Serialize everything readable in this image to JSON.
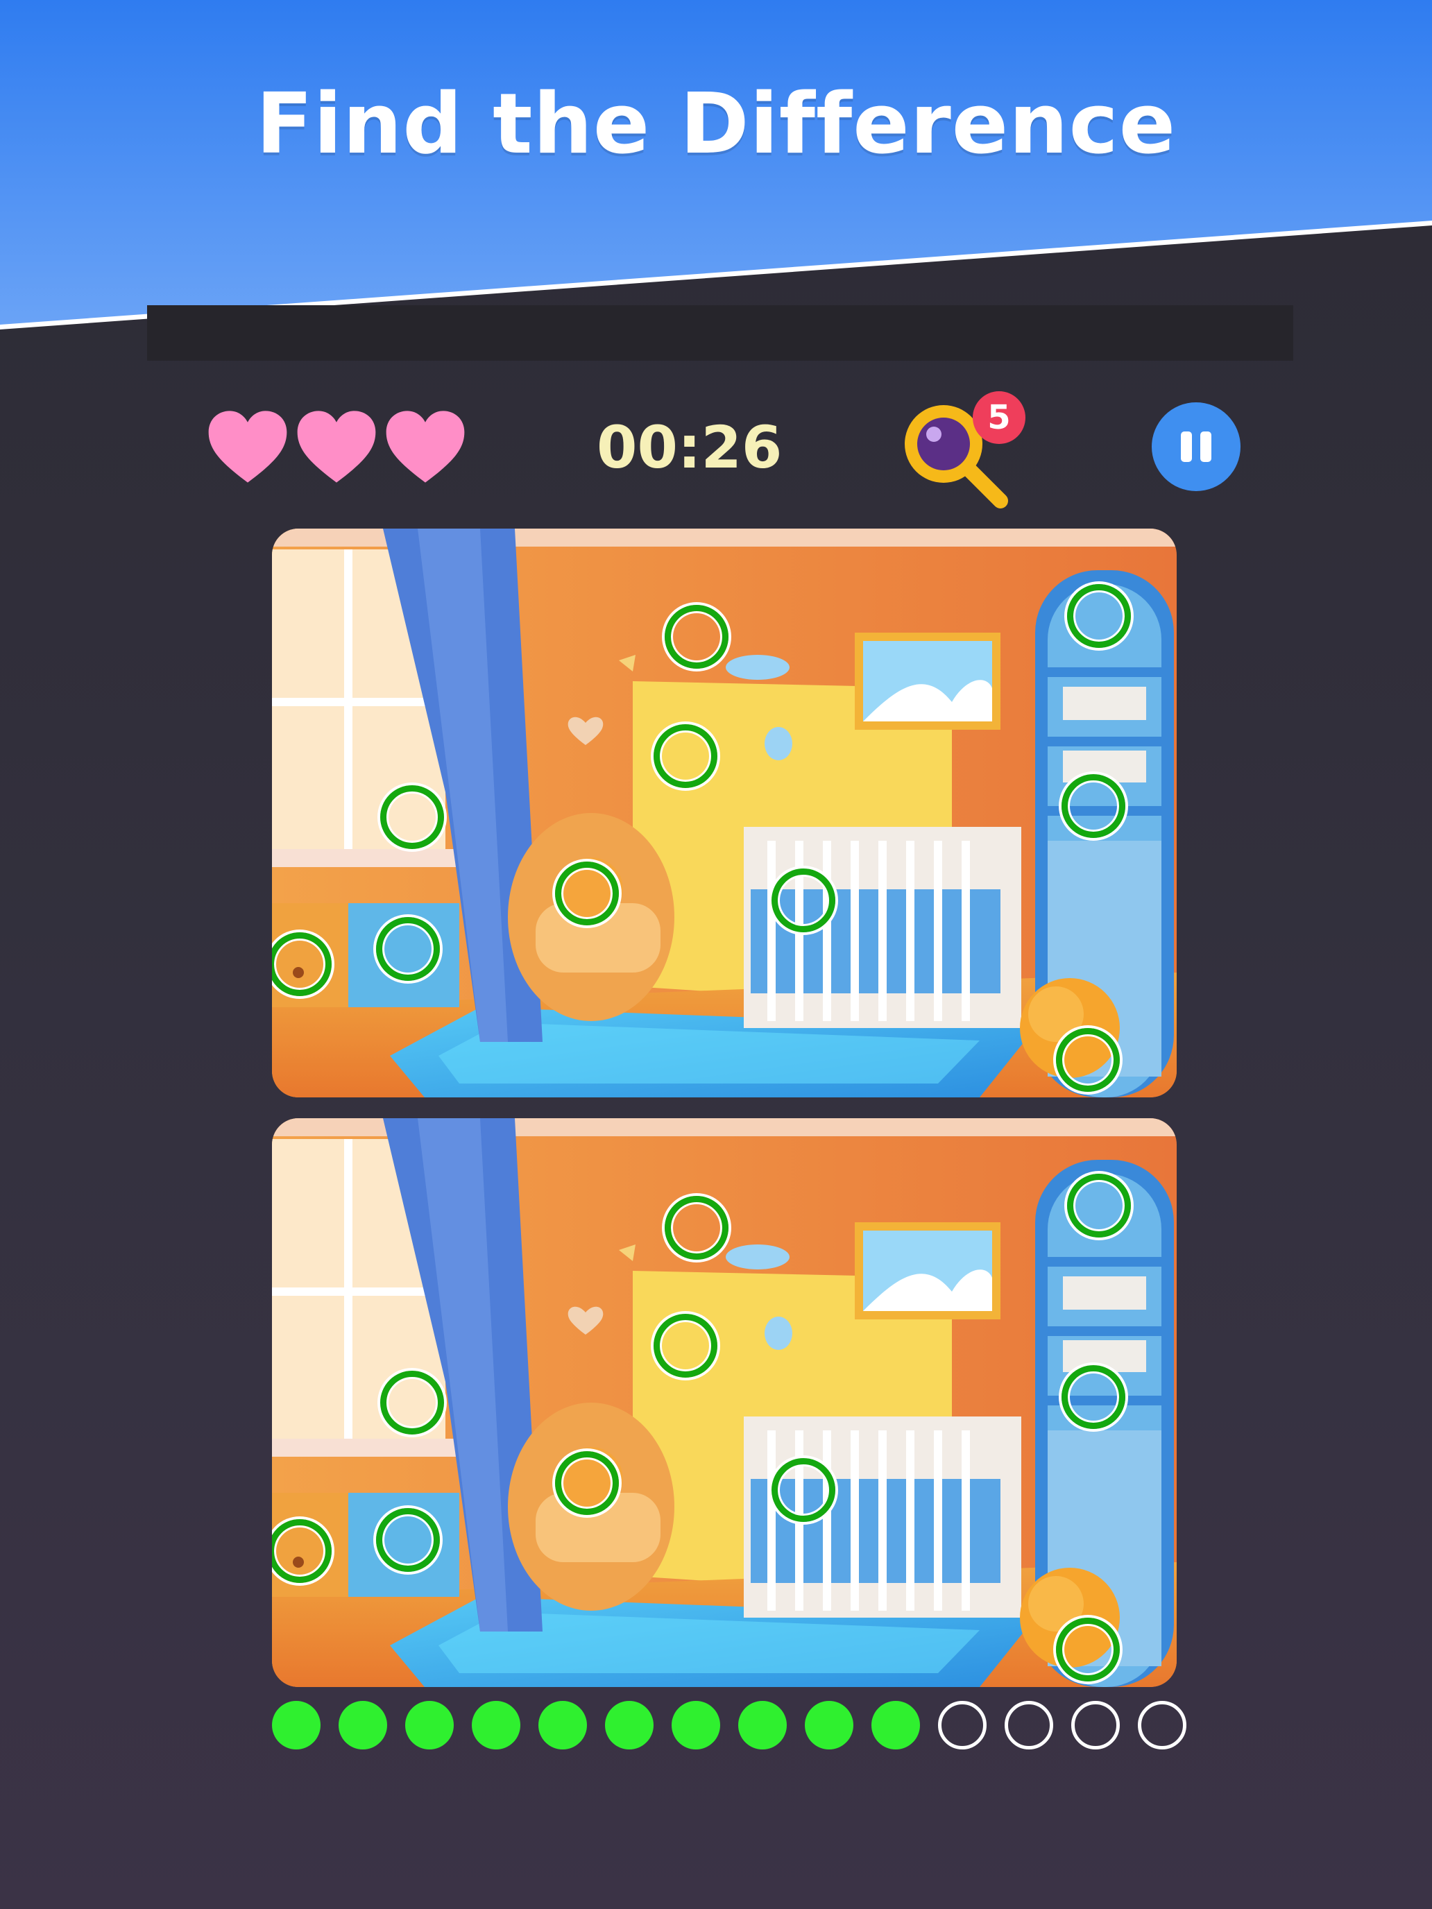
{
  "header": {
    "title": "Find the Difference"
  },
  "hud": {
    "lives": 3,
    "timer": "00:26",
    "hints_count": "5"
  },
  "progress": {
    "found": 10,
    "total": 14
  },
  "colors": {
    "banner_top": "#2f7cf0",
    "banner_bottom": "#6aa3f6",
    "heart": "#ff8ec7",
    "timer_text": "#f6f0b8",
    "badge": "#ef3e5b",
    "pause_button": "#3f8ff0",
    "found_marker": "#14a80f",
    "progress_found": "#2ff02f"
  },
  "icons": {
    "life": "heart-icon",
    "hint": "magnifier-icon",
    "pause": "pause-icon"
  }
}
